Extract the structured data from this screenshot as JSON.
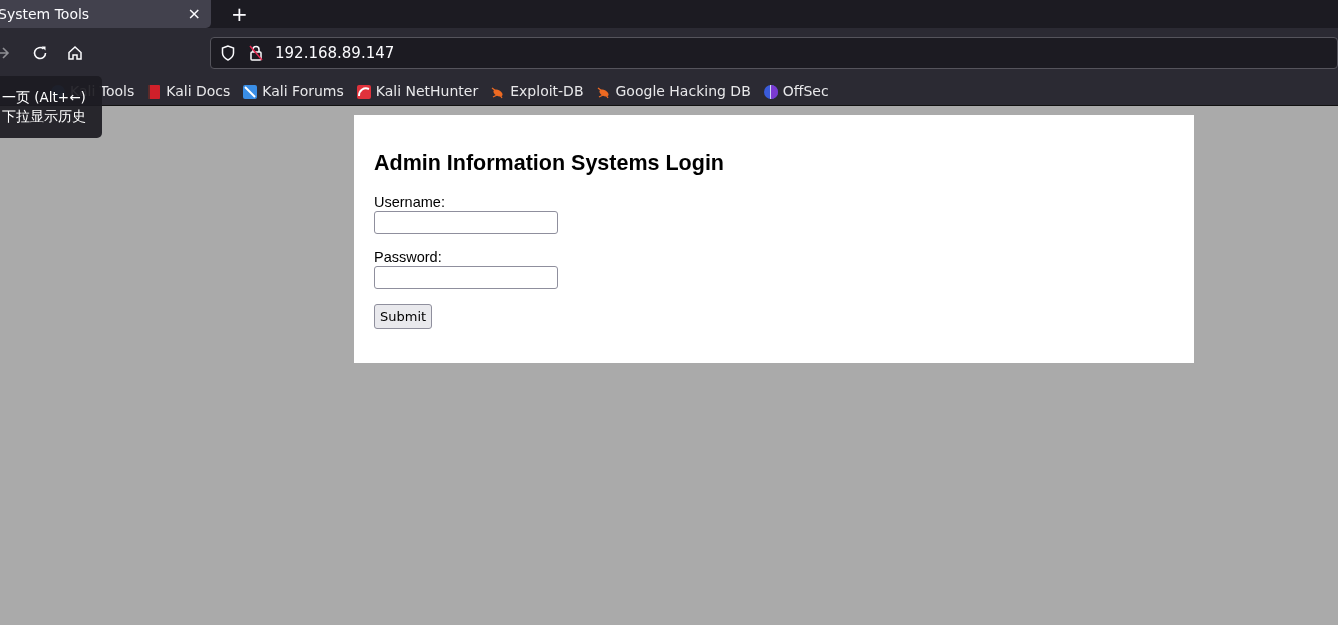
{
  "tab": {
    "title": "System Tools",
    "close": "×"
  },
  "new_tab": "+",
  "address": "192.168.89.147",
  "bookmarks": [
    {
      "label": "Kali Tools",
      "kind": "kali"
    },
    {
      "label": "Kali Docs",
      "kind": "docs"
    },
    {
      "label": "Kali Forums",
      "kind": "forums"
    },
    {
      "label": "Kali NetHunter",
      "kind": "nethunter"
    },
    {
      "label": "Exploit-DB",
      "kind": "bug"
    },
    {
      "label": "Google Hacking DB",
      "kind": "bug"
    },
    {
      "label": "OffSec",
      "kind": "offsec"
    }
  ],
  "tooltip": [
    "一页 (Alt+←)",
    "下拉显示历史"
  ],
  "form": {
    "title": "Admin Information Systems Login",
    "fields": [
      {
        "label": "Username:"
      },
      {
        "label": "Password:"
      }
    ],
    "submit": "Submit"
  }
}
